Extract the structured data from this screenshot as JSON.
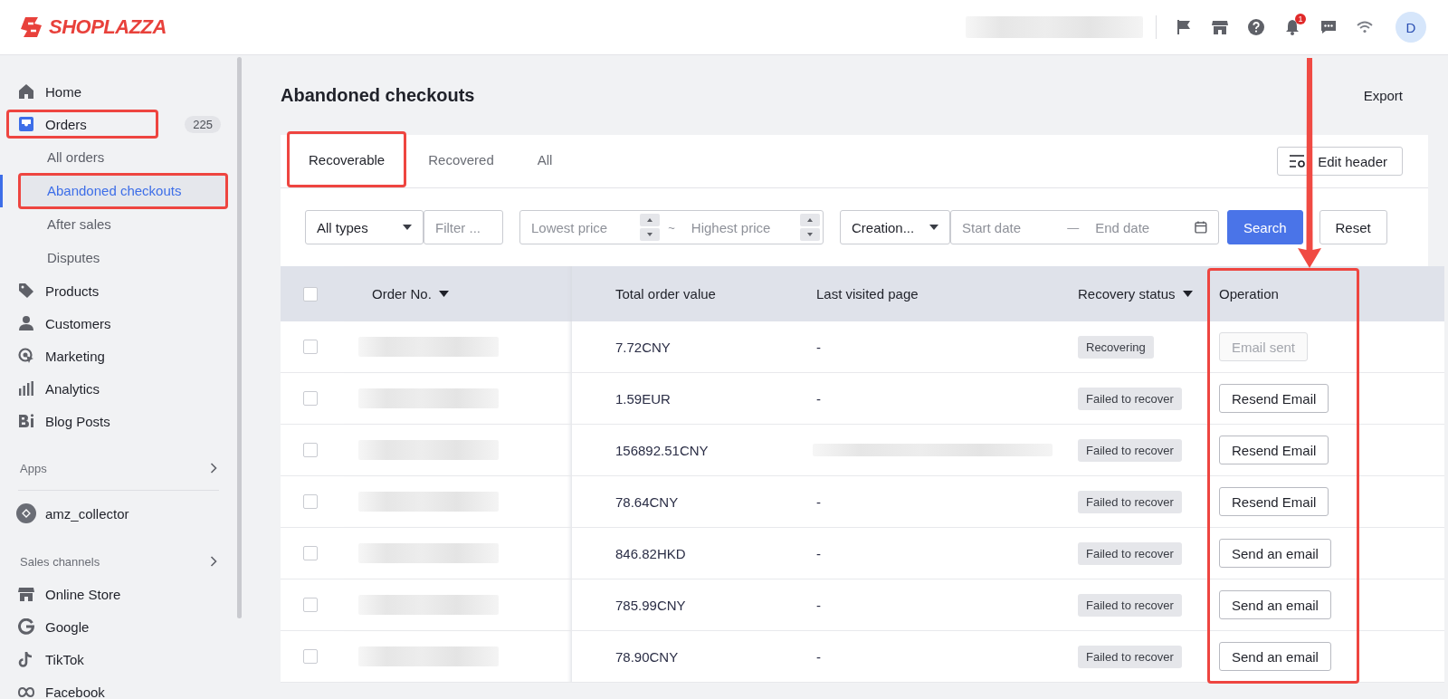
{
  "topbar": {
    "logo": "SHOPLAZZA",
    "notification_count": "1",
    "avatar": "D"
  },
  "sidebar": {
    "items": [
      {
        "kind": "nav",
        "label": "Home",
        "selected": false,
        "highlighted": false
      },
      {
        "kind": "nav",
        "label": "Orders",
        "count": "225",
        "selected": true,
        "highlighted": true,
        "children": [
          {
            "label": "All orders",
            "selected": false,
            "highlighted": false
          },
          {
            "label": "Abandoned checkouts",
            "selected": true,
            "highlighted": true
          },
          {
            "label": "After sales",
            "selected": false,
            "highlighted": false
          },
          {
            "label": "Disputes",
            "selected": false,
            "highlighted": false
          }
        ]
      },
      {
        "kind": "nav",
        "label": "Products",
        "selected": false,
        "highlighted": false
      },
      {
        "kind": "nav",
        "label": "Customers",
        "selected": false,
        "highlighted": false
      },
      {
        "kind": "nav",
        "label": "Marketing",
        "selected": false,
        "highlighted": false
      },
      {
        "kind": "nav",
        "label": "Analytics",
        "selected": false,
        "highlighted": false
      },
      {
        "kind": "nav",
        "label": "Blog Posts",
        "selected": false,
        "highlighted": false
      },
      {
        "kind": "section",
        "label": "Apps"
      },
      {
        "kind": "app",
        "label": "amz_collector"
      },
      {
        "kind": "section",
        "label": "Sales channels"
      },
      {
        "kind": "nav",
        "label": "Online Store",
        "selected": false,
        "highlighted": false
      },
      {
        "kind": "nav",
        "label": "Google",
        "selected": false,
        "highlighted": false
      },
      {
        "kind": "nav",
        "label": "TikTok",
        "selected": false,
        "highlighted": false
      },
      {
        "kind": "nav",
        "label": "Facebook",
        "selected": false,
        "highlighted": false
      }
    ]
  },
  "page": {
    "title": "Abandoned checkouts",
    "export": "Export"
  },
  "tabs": [
    {
      "label": "Recoverable",
      "selected": true,
      "highlighted": true
    },
    {
      "label": "Recovered",
      "selected": false,
      "highlighted": false
    },
    {
      "label": "All",
      "selected": false,
      "highlighted": false
    }
  ],
  "edit_header": "Edit header",
  "filters": {
    "type_select": "All types",
    "filter_placeholder": "Filter ...",
    "min_placeholder": "Lowest price",
    "separator": "~",
    "max_placeholder": "Highest price",
    "date_type": "Creation...",
    "start_placeholder": "Start date",
    "date_separator": "—",
    "end_placeholder": "End date",
    "search": "Search",
    "reset": "Reset"
  },
  "table": {
    "all_checked": false,
    "columns": [
      {
        "label": "Order No.",
        "sortable": true,
        "highlighted": false
      },
      {
        "label": "Total order value",
        "sortable": false,
        "highlighted": false
      },
      {
        "label": "Last visited page",
        "sortable": false,
        "highlighted": false
      },
      {
        "label": "Recovery status",
        "sortable": true,
        "highlighted": false
      },
      {
        "label": "Operation",
        "sortable": false,
        "highlighted": true,
        "arrow": true
      }
    ],
    "rows": [
      {
        "checked": false,
        "total": "7.72CNY",
        "last_visited": "-",
        "status": "Recovering",
        "action": {
          "label": "Email sent",
          "disabled": true
        }
      },
      {
        "checked": false,
        "total": "1.59EUR",
        "last_visited": "-",
        "status": "Failed to recover",
        "action": {
          "label": "Resend Email",
          "disabled": false
        }
      },
      {
        "checked": false,
        "total": "156892.51CNY",
        "status": "Failed to recover",
        "action": {
          "label": "Resend Email",
          "disabled": false
        }
      },
      {
        "checked": false,
        "total": "78.64CNY",
        "last_visited": "-",
        "status": "Failed to recover",
        "action": {
          "label": "Resend Email",
          "disabled": false
        }
      },
      {
        "checked": false,
        "total": "846.82HKD",
        "last_visited": "-",
        "status": "Failed to recover",
        "action": {
          "label": "Send an email",
          "disabled": false
        }
      },
      {
        "checked": false,
        "total": "785.99CNY",
        "last_visited": "-",
        "status": "Failed to recover",
        "action": {
          "label": "Send an email",
          "disabled": false
        }
      },
      {
        "checked": false,
        "total": "78.90CNY",
        "last_visited": "-",
        "status": "Failed to recover",
        "action": {
          "label": "Send an email",
          "disabled": false
        }
      }
    ]
  }
}
